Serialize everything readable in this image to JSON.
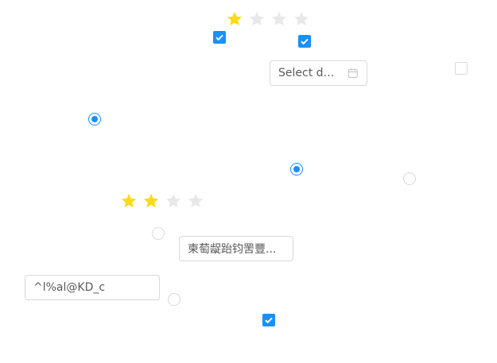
{
  "colors": {
    "primary": "#1890ff",
    "star_active": "#fadb14",
    "star_inactive": "#e8e8e8",
    "border": "#d9d9d9"
  },
  "ratings": [
    {
      "value": 1,
      "max": 4
    },
    {
      "value": 2,
      "max": 4
    }
  ],
  "checkboxes": [
    {
      "checked": true
    },
    {
      "checked": true
    },
    {
      "checked": false
    },
    {
      "checked": true
    }
  ],
  "radios": [
    {
      "checked": true
    },
    {
      "checked": true
    },
    {
      "checked": false
    },
    {
      "checked": false
    },
    {
      "checked": false
    }
  ],
  "date_picker": {
    "placeholder": "Select date",
    "icon": "calendar-icon"
  },
  "select": {
    "value": "柬萄龊跆钧罟豐..."
  },
  "text_input": {
    "value": "^l%al@KD_c"
  }
}
